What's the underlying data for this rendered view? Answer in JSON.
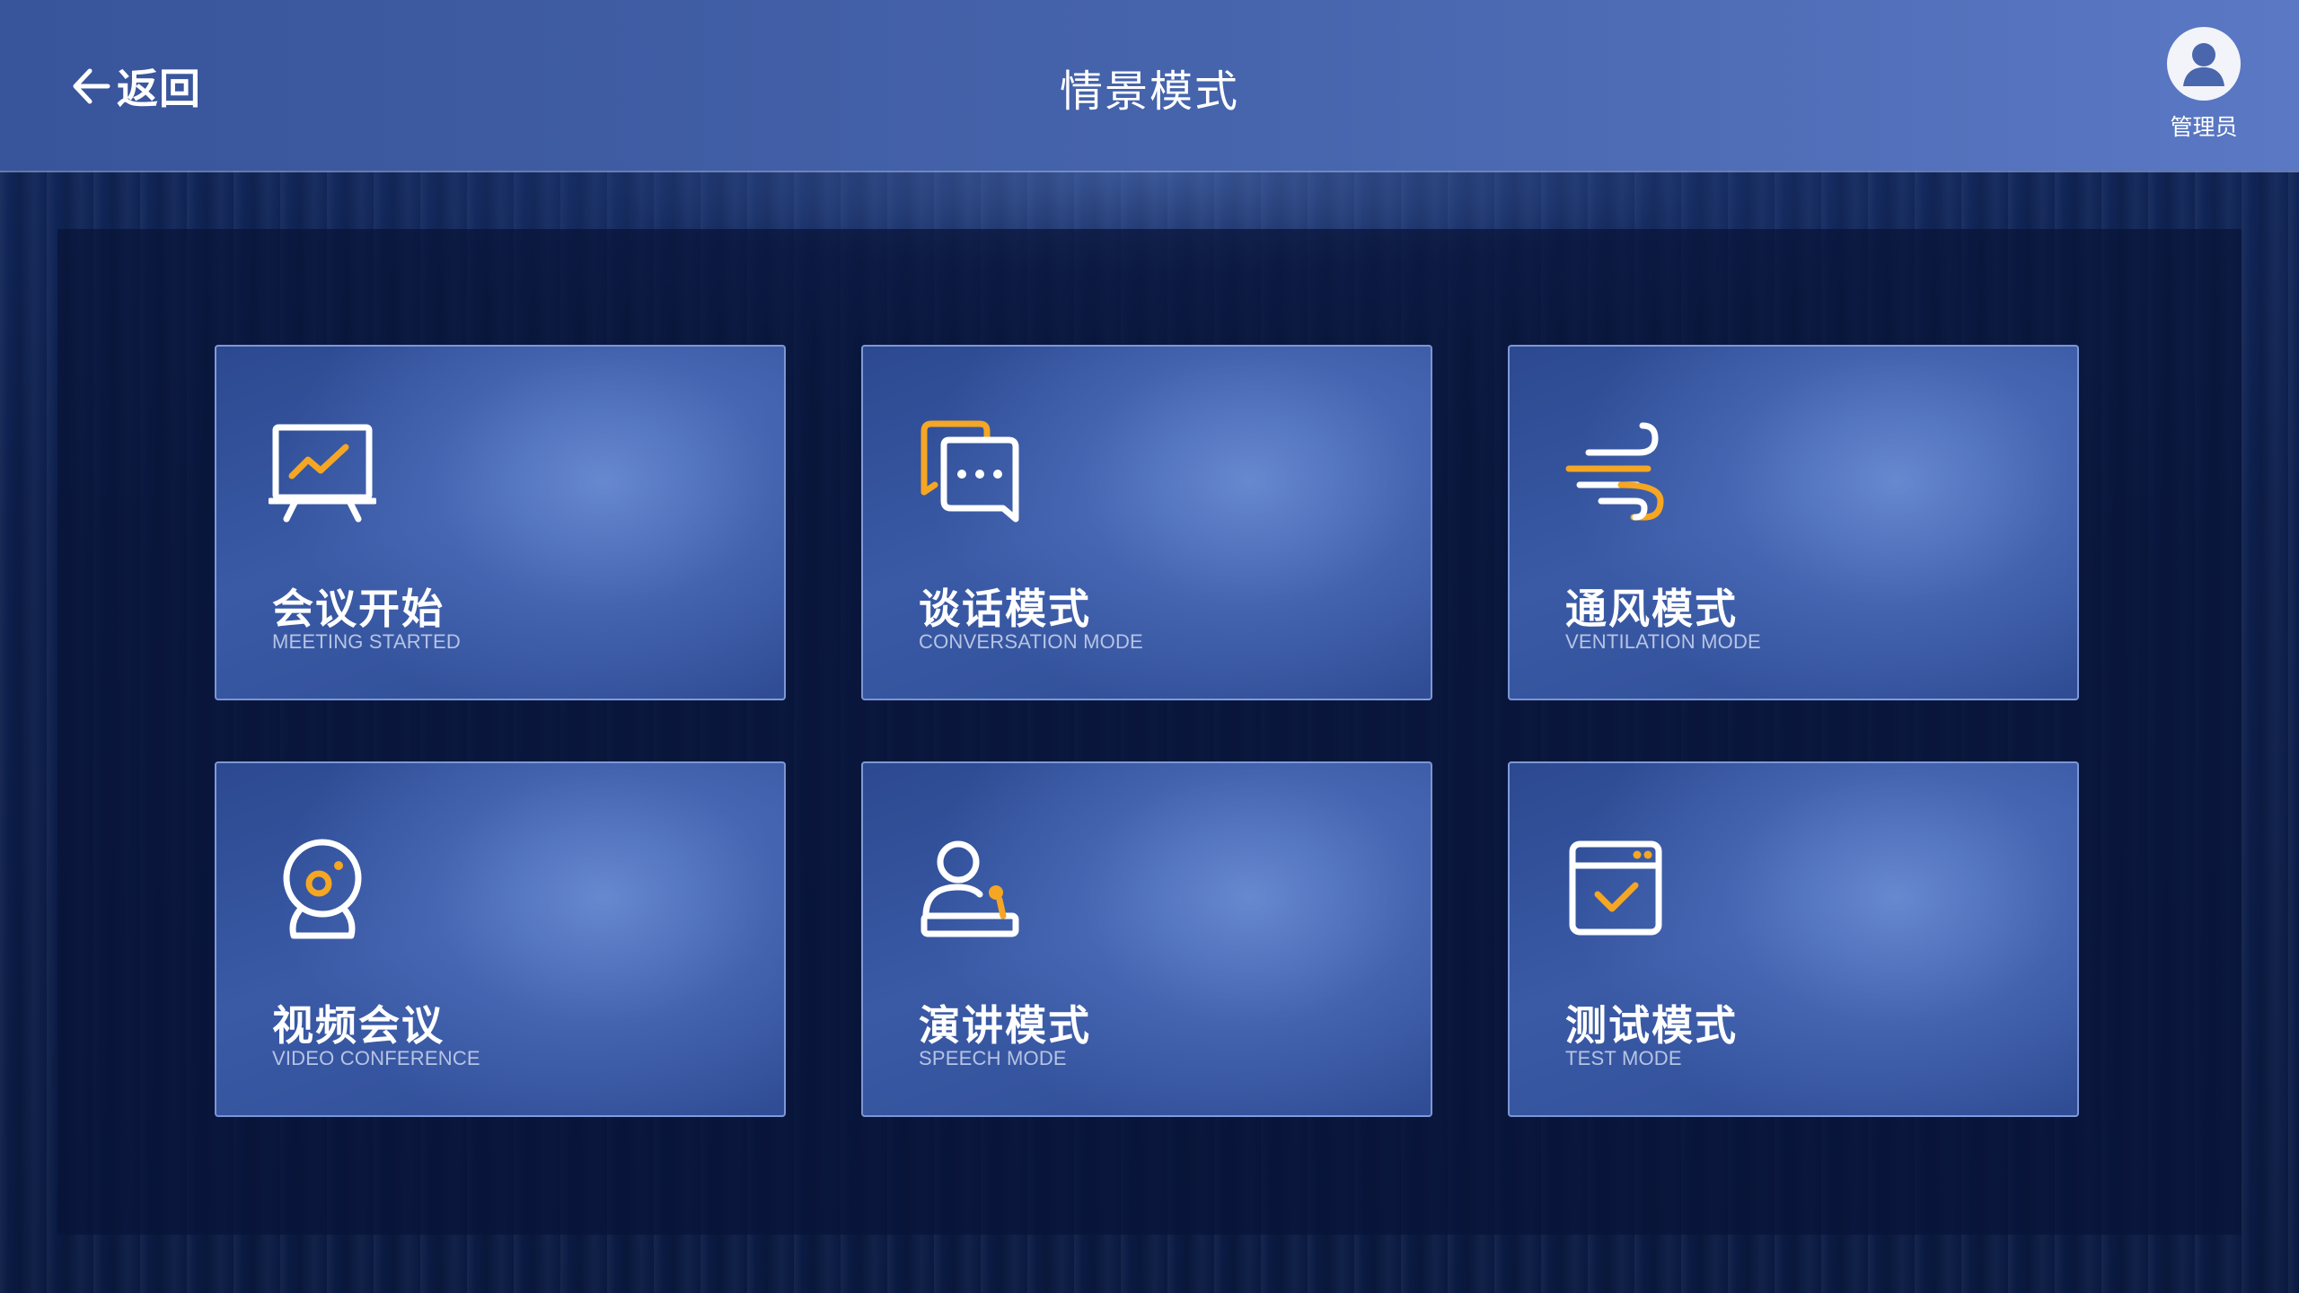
{
  "header": {
    "back_label": "返回",
    "title": "情景模式",
    "user_name": "管理员"
  },
  "colors": {
    "header_start": "#38549a",
    "header_end": "#5a78c4",
    "background": "#0b1a42",
    "card": "#3a5aa6",
    "icon_primary": "#ffffff",
    "icon_accent": "#f5a623"
  },
  "modes": [
    {
      "title": "会议开始",
      "subtitle": "MEETING STARTED",
      "icon": "presentation-chart-icon"
    },
    {
      "title": "谈话模式",
      "subtitle": "CONVERSATION MODE",
      "icon": "chat-bubbles-icon"
    },
    {
      "title": "通风模式",
      "subtitle": "VENTILATION MODE",
      "icon": "wind-icon"
    },
    {
      "title": "视频会议",
      "subtitle": "VIDEO CONFERENCE",
      "icon": "webcam-icon"
    },
    {
      "title": "演讲模式",
      "subtitle": "SPEECH MODE",
      "icon": "speaker-podium-icon"
    },
    {
      "title": "测试模式",
      "subtitle": "TEST MODE",
      "icon": "window-check-icon"
    }
  ]
}
